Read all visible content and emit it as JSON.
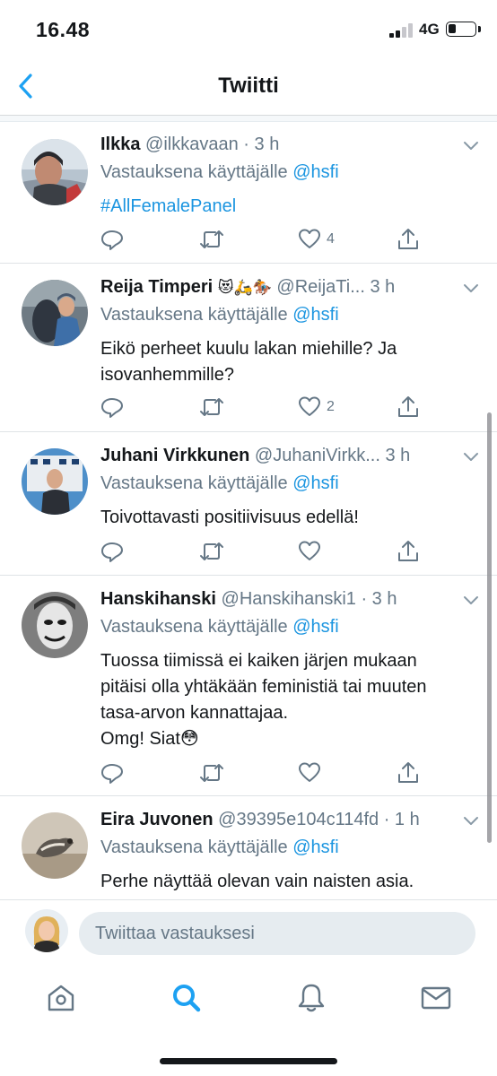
{
  "status_bar": {
    "time": "16.48",
    "network": "4G"
  },
  "nav": {
    "title": "Twiitti"
  },
  "tweets": [
    {
      "name": "Ilkka",
      "handle": "@ilkkavaan",
      "time": "· 3 h",
      "reply_prefix": "Vastauksena käyttäjälle",
      "reply_to": "@hsfi",
      "text": "#AllFemalePanel",
      "likes": "4"
    },
    {
      "name": "Reija Timperi",
      "emoji": "😻🛵🏇",
      "handle": "@ReijaTi...",
      "time": "3 h",
      "reply_prefix": "Vastauksena käyttäjälle",
      "reply_to": "@hsfi",
      "text_line1": "Eikö perheet kuulu lakan miehille? Ja",
      "text_line2": "isovanhemmille?",
      "likes": "2"
    },
    {
      "name": "Juhani Virkkunen",
      "handle": "@JuhaniVirkk...",
      "time": "3 h",
      "reply_prefix": "Vastauksena käyttäjälle",
      "reply_to": "@hsfi",
      "text": "Toivottavasti positiivisuus edellä!",
      "likes": ""
    },
    {
      "name": "Hanskihanski",
      "handle": "@Hanskihanski1",
      "time": "· 3 h",
      "reply_prefix": "Vastauksena käyttäjälle",
      "reply_to": "@hsfi",
      "text_line1": "Tuossa tiimissä ei kaiken järjen mukaan",
      "text_line2": "pitäisi olla yhtäkään feministiä tai muuten",
      "text_line3": "tasa-arvon kannattajaa.",
      "text_line4": "Omg! Siat😳",
      "likes": ""
    },
    {
      "name": "Eira Juvonen",
      "handle": "@39395e104c114fd",
      "time": "· 1 h",
      "reply_prefix": "Vastauksena käyttäjälle",
      "reply_to": "@hsfi",
      "text": "Perhe näyttää olevan vain naisten asia."
    }
  ],
  "compose": {
    "placeholder": "Twiittaa vastauksesi"
  },
  "tabs": [
    "home-icon",
    "search-icon",
    "notifications-icon",
    "messages-icon"
  ],
  "colors": {
    "accent": "#1da1f2",
    "link": "#1b95e0",
    "secondary_text": "#657786",
    "icon_gray": "#657786"
  }
}
